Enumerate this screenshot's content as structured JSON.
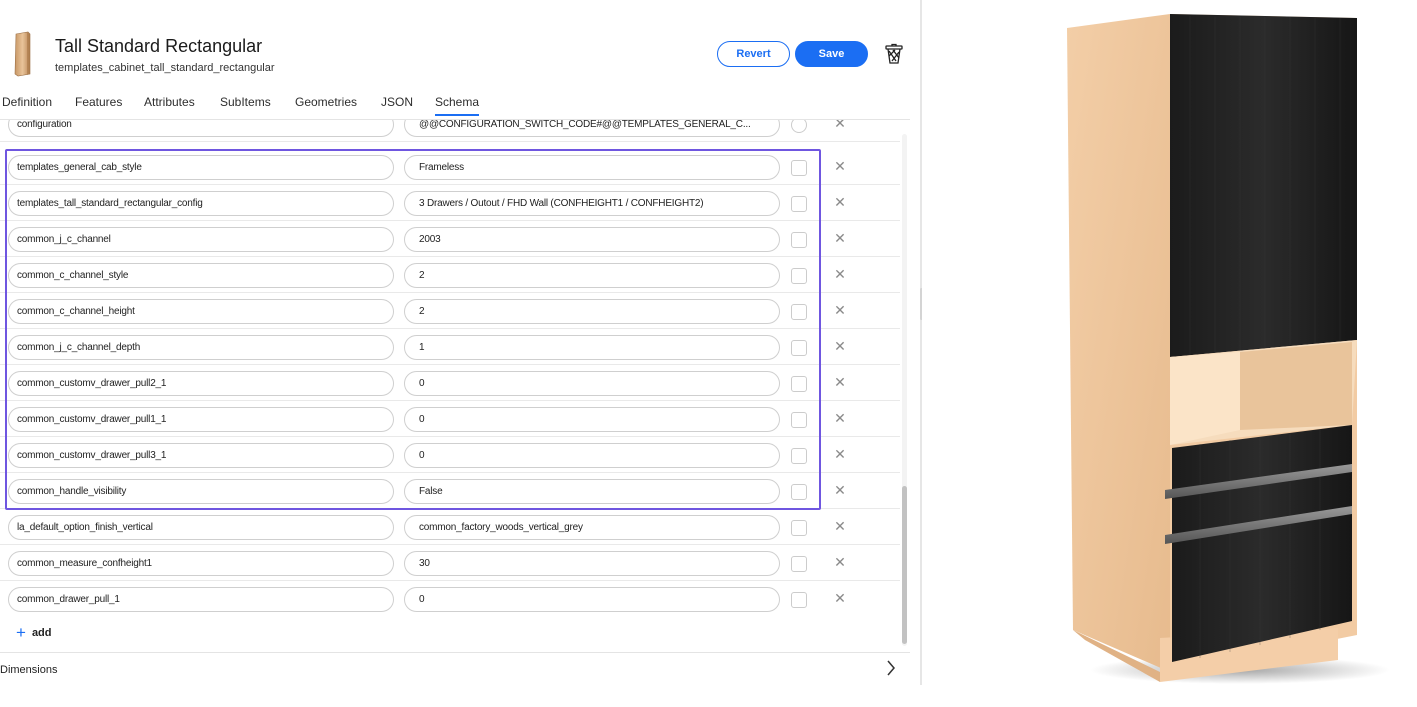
{
  "header": {
    "title": "Tall Standard Rectangular",
    "subtitle": "templates_cabinet_tall_standard_rectangular",
    "revert_label": "Revert",
    "save_label": "Save"
  },
  "tabs": [
    {
      "label": "Definition"
    },
    {
      "label": "Features"
    },
    {
      "label": "Attributes"
    },
    {
      "label": "SubItems"
    },
    {
      "label": "Geometries"
    },
    {
      "label": "JSON"
    },
    {
      "label": "Schema",
      "active": true
    }
  ],
  "rows": [
    {
      "key": "configuration",
      "value": "@@CONFIGURATION_SWITCH_CODE#@@TEMPLATES_GENERAL_C...",
      "partial": true
    },
    {
      "key": "templates_general_cab_style",
      "value": "Frameless"
    },
    {
      "key": "templates_tall_standard_rectangular_config",
      "value": "3 Drawers / Outout / FHD Wall (CONFHEIGHT1 / CONFHEIGHT2)"
    },
    {
      "key": "common_j_c_channel",
      "value": "2003"
    },
    {
      "key": "common_c_channel_style",
      "value": "2"
    },
    {
      "key": "common_c_channel_height",
      "value": "2"
    },
    {
      "key": "common_j_c_channel_depth",
      "value": "1"
    },
    {
      "key": "common_customv_drawer_pull2_1",
      "value": "0"
    },
    {
      "key": "common_customv_drawer_pull1_1",
      "value": "0"
    },
    {
      "key": "common_customv_drawer_pull3_1",
      "value": "0"
    },
    {
      "key": "common_handle_visibility",
      "value": "False"
    },
    {
      "key": "la_default_option_finish_vertical",
      "value": "common_factory_woods_vertical_grey"
    },
    {
      "key": "common_measure_confheight1",
      "value": "30"
    },
    {
      "key": "common_drawer_pull_1",
      "value": "0"
    }
  ],
  "add_label": "add",
  "dimensions_label": "Dimensions",
  "colors": {
    "accent": "#1b6ef3",
    "selection": "#6f56e0",
    "cabinet_wood": "#f1c9a0",
    "door_finish": "#1e1e1e"
  },
  "icons": {
    "thumbnail": "cabinet-thumbnail-icon",
    "delete": "trash-can-icon",
    "row_remove": "close-x-icon",
    "expand": "chevron-right-icon",
    "add": "plus-icon"
  }
}
